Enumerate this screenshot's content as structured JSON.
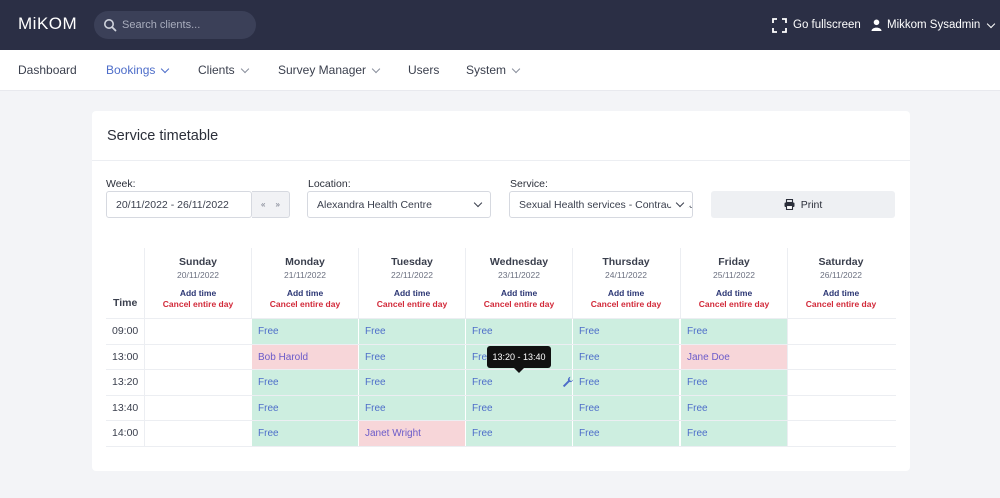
{
  "header": {
    "logo": "MiKOM",
    "search_placeholder": "Search clients...",
    "fullscreen_label": "Go fullscreen",
    "user_name": "Mikkom Sysadmin"
  },
  "nav": {
    "items": [
      {
        "label": "Dashboard",
        "has_dropdown": false
      },
      {
        "label": "Bookings",
        "has_dropdown": true,
        "active": true
      },
      {
        "label": "Clients",
        "has_dropdown": true
      },
      {
        "label": "Survey Manager",
        "has_dropdown": true
      },
      {
        "label": "Users",
        "has_dropdown": false
      },
      {
        "label": "System",
        "has_dropdown": true
      }
    ]
  },
  "page": {
    "title": "Service timetable",
    "week_label": "Week:",
    "week_value": "20/11/2022 - 26/11/2022",
    "week_prev": "«",
    "week_next": "»",
    "location_label": "Location:",
    "location_value": "Alexandra Health Centre",
    "service_label": "Service:",
    "service_value": "Sexual Health services - Contraception",
    "print_label": "Print"
  },
  "timetable": {
    "time_header": "Time",
    "add_time_label": "Add time",
    "cancel_day_label": "Cancel entire day",
    "days": [
      {
        "name": "Sunday",
        "date": "20/11/2022"
      },
      {
        "name": "Monday",
        "date": "21/11/2022"
      },
      {
        "name": "Tuesday",
        "date": "22/11/2022"
      },
      {
        "name": "Wednesday",
        "date": "23/11/2022"
      },
      {
        "name": "Thursday",
        "date": "24/11/2022"
      },
      {
        "name": "Friday",
        "date": "25/11/2022"
      },
      {
        "name": "Saturday",
        "date": "26/11/2022"
      }
    ],
    "rows": [
      {
        "time": "09:00",
        "cells": [
          "",
          "Free",
          "Free",
          "Free",
          "Free",
          "Free",
          ""
        ]
      },
      {
        "time": "13:00",
        "cells": [
          "",
          "Bob Harold",
          "Free",
          "Free",
          "Free",
          "Jane Doe",
          ""
        ]
      },
      {
        "time": "13:20",
        "cells": [
          "",
          "Free",
          "Free",
          "Free",
          "Free",
          "Free",
          ""
        ]
      },
      {
        "time": "13:40",
        "cells": [
          "",
          "Free",
          "Free",
          "Free",
          "Free",
          "Free",
          ""
        ]
      },
      {
        "time": "14:00",
        "cells": [
          "",
          "Free",
          "Janet Wright",
          "Free",
          "Free",
          "Free",
          ""
        ]
      }
    ],
    "tooltip": "13:20 - 13:40"
  },
  "colors": {
    "topbar": "#2b2f45",
    "free_slot": "#cdeee0",
    "booked_slot": "#f7d6d9",
    "accent": "#4d6dc9",
    "cancel": "#d22a3a"
  },
  "icons": [
    "search-icon",
    "fullscreen-icon",
    "user-icon",
    "printer-icon",
    "wrench-icon",
    "chevron-down-icon"
  ]
}
